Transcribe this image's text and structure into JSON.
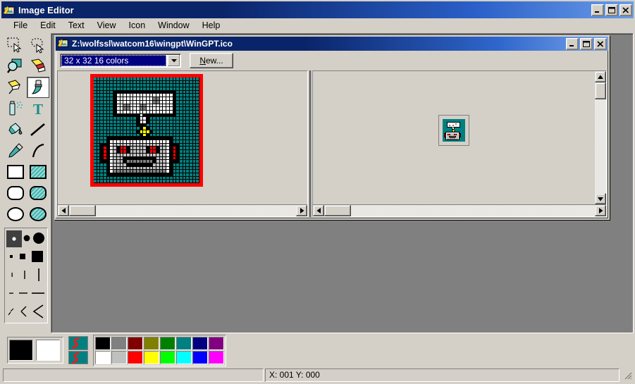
{
  "app": {
    "title": "Image Editor",
    "icon": "image-editor-icon",
    "window_buttons": [
      {
        "name": "minimize-button",
        "glyph": "minimize"
      },
      {
        "name": "maximize-button",
        "glyph": "maximize"
      },
      {
        "name": "close-button",
        "glyph": "close"
      }
    ]
  },
  "menu": {
    "items": [
      {
        "label": "File"
      },
      {
        "label": "Edit"
      },
      {
        "label": "Text"
      },
      {
        "label": "View"
      },
      {
        "label": "Icon"
      },
      {
        "label": "Window"
      },
      {
        "label": "Help"
      }
    ]
  },
  "toolbox": {
    "tools": [
      {
        "name": "rectangle-select-tool",
        "selected": false
      },
      {
        "name": "freeform-select-tool",
        "selected": false
      },
      {
        "name": "magnifier-tool",
        "selected": false
      },
      {
        "name": "eraser-tool",
        "selected": false
      },
      {
        "name": "marker-tool",
        "selected": false
      },
      {
        "name": "paintbrush-tool",
        "selected": true
      },
      {
        "name": "spraycan-tool",
        "selected": false
      },
      {
        "name": "text-tool",
        "selected": false
      },
      {
        "name": "paint-bucket-tool",
        "selected": false
      },
      {
        "name": "line-tool",
        "selected": false
      },
      {
        "name": "eyedropper-tool",
        "selected": false
      },
      {
        "name": "curve-tool",
        "selected": false
      },
      {
        "name": "rectangle-tool",
        "selected": false
      },
      {
        "name": "filled-rectangle-tool",
        "selected": false
      },
      {
        "name": "rounded-rectangle-tool",
        "selected": false
      },
      {
        "name": "filled-rounded-rectangle-tool",
        "selected": false
      },
      {
        "name": "ellipse-tool",
        "selected": false
      },
      {
        "name": "filled-ellipse-tool",
        "selected": false
      }
    ],
    "brush_shapes": {
      "selected_index": 0,
      "rows": [
        [
          "dot-small",
          "circle-medium",
          "circle-large"
        ],
        [
          "square-small",
          "square-medium",
          "square-large"
        ],
        [
          "vline-small",
          "vline-medium",
          "vline-large"
        ],
        [
          "hline-small",
          "hline-medium",
          "hline-large"
        ],
        [
          "diagonal-small",
          "diagonal-medium",
          "diagonal-large"
        ]
      ]
    }
  },
  "child_window": {
    "title": "Z:\\wolfssl\\watcom16\\wingpt\\WinGPT.ico",
    "icon": "image-editor-icon",
    "window_buttons": [
      {
        "name": "child-minimize-button",
        "glyph": "minimize"
      },
      {
        "name": "child-maximize-button",
        "glyph": "maximize"
      },
      {
        "name": "child-close-button",
        "glyph": "close"
      }
    ],
    "format_combo": {
      "value": "32 x 32  16 colors",
      "options": [
        "32 x 32  16 colors"
      ]
    },
    "new_button": {
      "label_before": "",
      "accel": "N",
      "label_after": "ew..."
    }
  },
  "status": {
    "left_panel": "",
    "coords": "X: 001  Y: 000"
  },
  "palette": {
    "foreground": "#000000",
    "background": "#ffffff",
    "gradient_swatches": [
      "gradient-swatch-1",
      "gradient-swatch-2"
    ],
    "row1": [
      "#000000",
      "#808080",
      "#800000",
      "#808000",
      "#008000",
      "#008080",
      "#000080",
      "#800080"
    ],
    "row2": [
      "#ffffff",
      "#c0c0c0",
      "#ff0000",
      "#ffff00",
      "#00ff00",
      "#00ffff",
      "#0000ff",
      "#ff00ff"
    ]
  },
  "icon_art": {
    "width": 32,
    "height": 32,
    "grid_border_color": "#ff0000",
    "colors": {
      "bg": "#008080",
      "white": "#ffffff",
      "ltgray": "#c0c0c0",
      "gray": "#808080",
      "dkgray": "#404040",
      "black": "#000000",
      "red": "#ff0000",
      "yellow": "#ffff00"
    },
    "legend": {
      ".": "bg",
      "K": "black",
      "W": "white",
      "L": "ltgray",
      "G": "gray",
      "D": "dkgray",
      "R": "red",
      "Y": "yellow"
    },
    "rows": [
      "................................",
      "................................",
      "................................",
      "................................",
      "......KKKKKKKKKKKKKKKKKKK.......",
      "......KWWWWWWWWWWWWWWWWWK.......",
      "......KWWWWWWWWWWWGGWWWWK.......",
      "......KWWWWWWWWWWWGGWWWWK.......",
      "......KWWGGWWWGGWWWWWWWWK.......",
      "......KWWGGWWWGGWWWWWWWWK.......",
      "......KWWWWWWWWWWWWWWWWWK.......",
      "......KKKKKKKKWKKKKKKKKKK.......",
      ".............KWWK...............",
      ".............KWWK...............",
      ".............KKK................",
      "..............KYK...............",
      ".............KYYYK..............",
      "..............KYK...............",
      "....KKKKKKKKKKKKKKKKKKKK........",
      "....KWWWWWWWWWWWWWWWWWWK........",
      "..KKKWLLLLLLLLLLLLLLLLWKKK......",
      "..KRKWLKRRKLLLLLKRRKLLWKRK......",
      "..KRKWLKRRKLLLLLKRRKLLWKRK......",
      "..KRKWLLLLLLLLLLLLLLLLWKRK......",
      "..KRKWLLLKKKKKKKKKKLLLWKRK......",
      "..KKKWLLLKGGGGGGGGKLLLWKKK......",
      "....KWLLLLKKKKKKKKLLLLWK........",
      "....KWLLLLLLLLLLLLLLLLWK........",
      "....KWGGGGGGGGGGGGGGGGWK........",
      "....KKKKKKKKKKKKKKKKKKKK........",
      "................................",
      "................................"
    ]
  },
  "scrollbars": {
    "left_pane_h": {
      "name": "left-pane-hscrollbar"
    },
    "right_pane_h": {
      "name": "right-pane-hscrollbar"
    },
    "right_pane_v": {
      "name": "right-pane-vscrollbar"
    }
  }
}
